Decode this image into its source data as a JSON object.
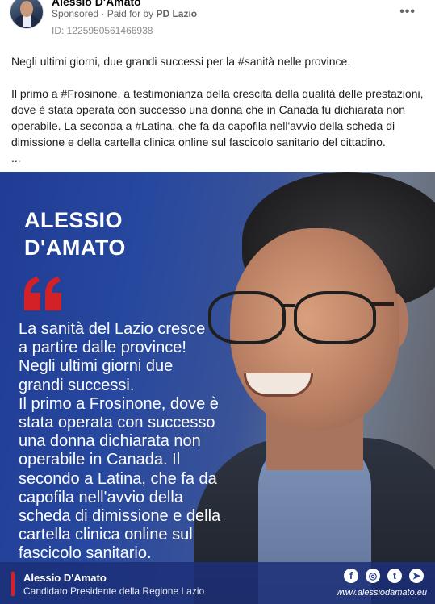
{
  "post": {
    "author": "Alessio D'Amato",
    "sponsored": "Sponsored",
    "paid_for_prefix": "Paid for by",
    "paid_for_by": "PD Lazio",
    "ad_id": "ID: 1225950561466938",
    "more_icon": "•••",
    "text": {
      "para1": "Negli ultimi giorni, due grandi successi per la #sanità nelle province.",
      "para2": "Il primo a #Frosinone, a testimonianza della crescita della qualità delle prestazioni, dove è stata operata con successo una donna che in Canada fu dichiarata non operabile. La seconda a #Latina, che fa da capofila nell'avvio della scheda di dimissione e della cartella clinica online sul fascicolo sanitario del cittadino.",
      "ellipsis": "..."
    }
  },
  "creative": {
    "headline_line1": "ALESSIO",
    "headline_line2": "D'AMATO",
    "quote_lines": [
      "La sanità del Lazio cresce",
      "a partire dalle province!",
      "Negli ultimi giorni due",
      "grandi successi.",
      "Il primo a Frosinone, dove è",
      "stata operata con successo",
      "una donna dichiarata non",
      "operabile in Canada. Il",
      "secondo a Latina, che fa da",
      "capofila nell'avvio della",
      "scheda di dimissione e della",
      "cartella clinica online sul",
      "fascicolo sanitario."
    ],
    "footer_name": "Alessio D'Amato",
    "footer_role": "Candidato Presidente della Regione Lazio",
    "website": "www.alessiodamato.eu",
    "social_icons": [
      "facebook-icon",
      "instagram-icon",
      "twitter-icon",
      "telegram-icon"
    ],
    "social_glyphs": [
      "f",
      "◎",
      "t",
      "➤"
    ],
    "colors": {
      "brand_blue": "#203c95",
      "accent_red": "#d42027"
    }
  }
}
